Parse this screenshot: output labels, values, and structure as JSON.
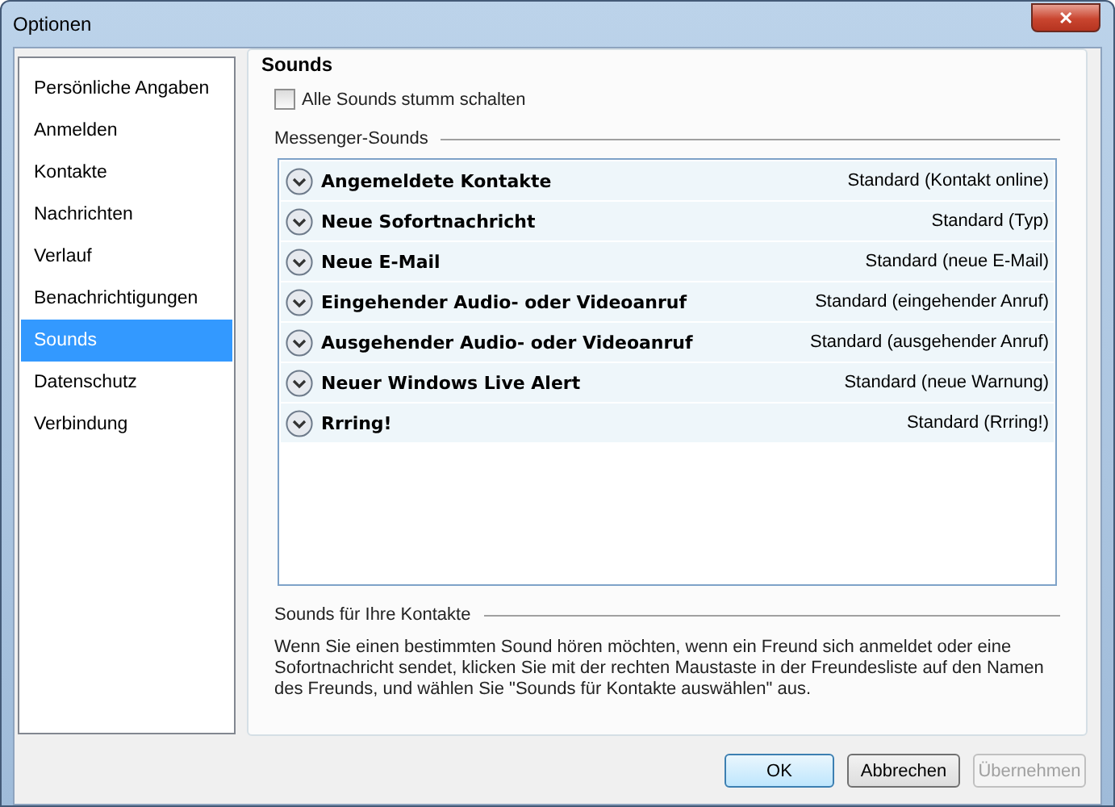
{
  "window": {
    "title": "Optionen",
    "close": "✕"
  },
  "sidebar": {
    "items": [
      {
        "label": "Persönliche Angaben",
        "selected": false
      },
      {
        "label": "Anmelden",
        "selected": false
      },
      {
        "label": "Kontakte",
        "selected": false
      },
      {
        "label": "Nachrichten",
        "selected": false
      },
      {
        "label": "Verlauf",
        "selected": false
      },
      {
        "label": "Benachrichtigungen",
        "selected": false
      },
      {
        "label": "Sounds",
        "selected": true
      },
      {
        "label": "Datenschutz",
        "selected": false
      },
      {
        "label": "Verbindung",
        "selected": false
      }
    ]
  },
  "section": {
    "title": "Sounds",
    "mute_all": {
      "label": "Alle Sounds stumm schalten",
      "checked": false
    },
    "messenger_sounds": {
      "heading": "Messenger-Sounds",
      "rows": [
        {
          "event": "Angemeldete Kontakte",
          "sound": "Standard (Kontakt online)"
        },
        {
          "event": "Neue Sofortnachricht",
          "sound": "Standard (Typ)"
        },
        {
          "event": "Neue E-Mail",
          "sound": "Standard (neue E-Mail)"
        },
        {
          "event": "Eingehender Audio- oder Videoanruf",
          "sound": "Standard (eingehender Anruf)"
        },
        {
          "event": "Ausgehender Audio- oder Videoanruf",
          "sound": "Standard (ausgehender Anruf)"
        },
        {
          "event": "Neuer Windows Live Alert",
          "sound": "Standard (neue Warnung)"
        },
        {
          "event": "Rrring!",
          "sound": "Standard (Rrring!)"
        }
      ]
    },
    "contact_sounds": {
      "heading": "Sounds für Ihre Kontakte",
      "text": "Wenn Sie einen bestimmten Sound hören möchten, wenn ein Freund sich anmeldet oder eine Sofortnachricht sendet, klicken Sie mit der rechten Maustaste in der Freundesliste auf den Namen des Freunds, und wählen Sie \"Sounds für Kontakte auswählen\" aus."
    }
  },
  "buttons": [
    {
      "label": "OK",
      "disabled": false,
      "default": true
    },
    {
      "label": "Abbrechen",
      "disabled": false,
      "default": false
    },
    {
      "label": "Übernehmen",
      "disabled": true,
      "default": false
    }
  ]
}
